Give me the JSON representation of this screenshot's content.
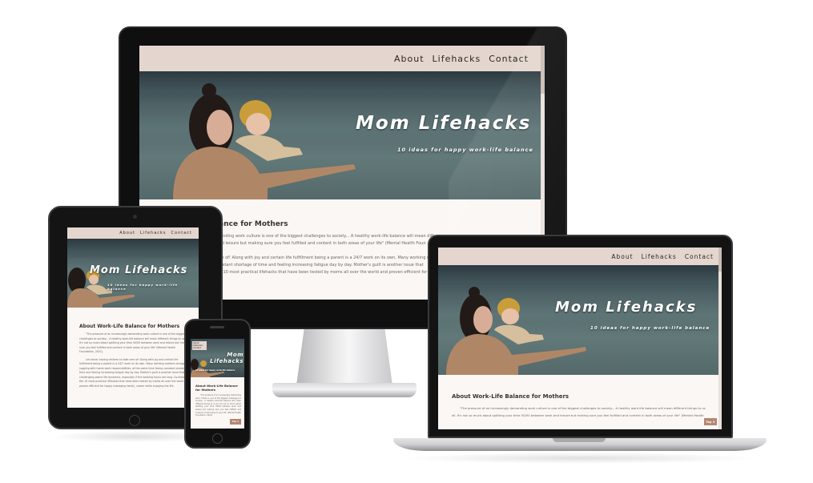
{
  "site": {
    "nav": [
      "About",
      "Lifehacks",
      "Contact"
    ],
    "hero_title": "Mom Lifehacks",
    "hero_subtitle": "10 ideas for happy work-life balance",
    "section_heading": "About Work-Life Balance for Mothers",
    "section_heading_imac_visible": "alance for Mothers",
    "paragraph_1": "\"The pressure of an increasingly demanding work culture is one of the biggest challenges to society... A healthy work-life balance will mean different things to us all. It's not so much about splitting your time 50/50 between work and leisure but making sure you feel fulfilled and content in both areas of your life\" (Mental Health Foundation, 2021).",
    "paragraph_1_laptop": "\"The pressure of an increasingly demanding work culture is one of the biggest challenges to society... A healthy work-life balance will mean different things to us all. It's not so much about splitting your time 50/50 between work and leisure but making sure you feel fulfilled and content in both areas of your life\" (Mental Health Foundation, 2021).",
    "paragraph_2": "Let alone: having children to take care of! Along with joy and certain life fulfillment being a parent is a 24/7 work on its own. Many working mothers struggle juggling with home work responsibilities, at the same time facing constant shortage of time and feeling increasing fatigue day by day. Mother's guilt is another issue that is challenging peace life dynamics, especially if the working hours are long. Go ahead to the 10 most practical lifehacks that have been tested by moms all over the world and proven efficient for happy managing family, career while enjoying the life.",
    "imac_lines": [
      "demanding work culture is one of the biggest challenges to society... A healthy work-life balance will mean diff",
      "rk and leisure but making sure you feel fulfilled and content in both areas of your life\" (Mental Health Foun",
      "",
      "e care of! Along with joy and certain life fulfillment being a parent is a 24/7 work on its own. Many working m",
      "g constant shortage of time and feeling increasing fatigue day by day. Mother's guilt is another issue that",
      "o the 10 most practical lifehacks that have been tested by moms all over the world and proven efficient for"
    ],
    "top_button": "Top ⬆"
  },
  "colors": {
    "nav_bg": "#e4d6cf",
    "page_bg": "#fbf7f4",
    "accent": "#b48772",
    "text_dark": "#3a332f",
    "device_frame": "#131314"
  }
}
